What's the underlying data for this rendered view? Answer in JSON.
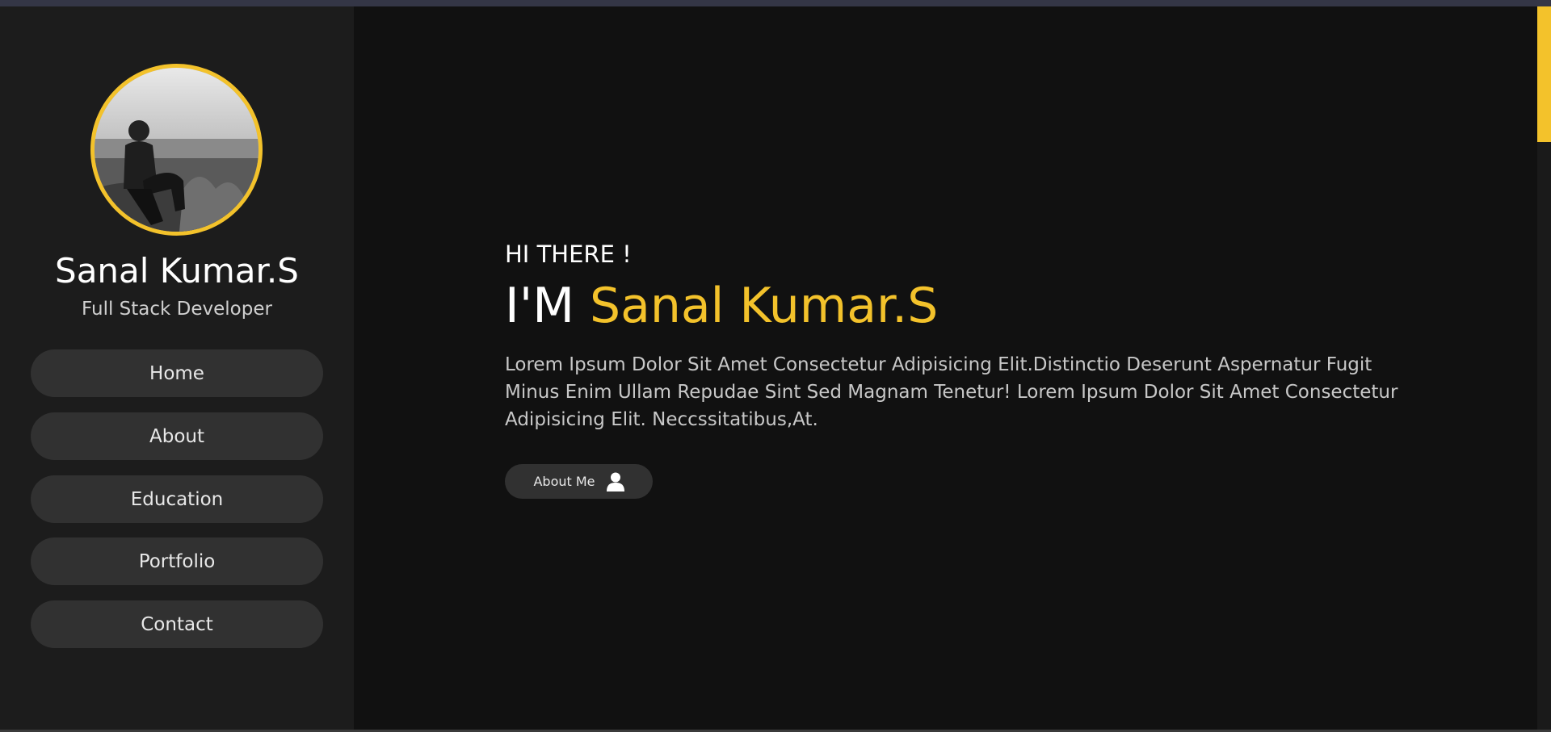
{
  "profile": {
    "name": "Sanal Kumar.S",
    "role": "Full Stack Developer"
  },
  "nav": {
    "items": [
      "Home",
      "About",
      "Education",
      "Portfolio",
      "Contact"
    ]
  },
  "hero": {
    "greeting": "HI THERE !",
    "im_prefix": "I'M ",
    "name": "Sanal Kumar.S",
    "description": "Lorem Ipsum Dolor Sit Amet Consectetur Adipisicing Elit.Distinctio Deserunt Aspernatur Fugit Minus Enim Ullam Repudae Sint Sed Magnam Tenetur! Lorem Ipsum Dolor Sit Amet Consectetur Adipisicing Elit. Neccssitatibus,At.",
    "about_button": "About Me",
    "about_icon": "user-icon"
  },
  "colors": {
    "accent": "#f3c22b",
    "sidebar_bg": "#1c1c1c",
    "main_bg": "#111111",
    "button_bg": "#313131"
  }
}
